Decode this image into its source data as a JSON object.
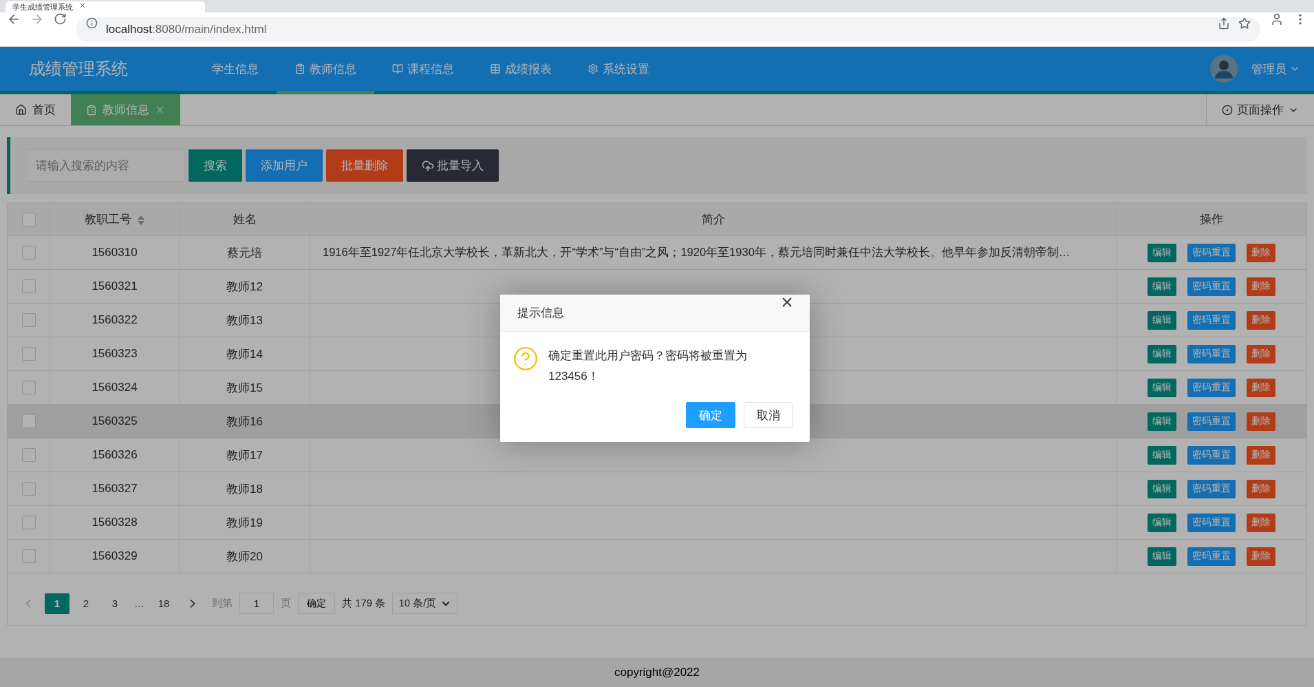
{
  "browser": {
    "tab_title": "学生成绩管理系统",
    "url_host": "localhost",
    "url_rest": ":8080/main/index.html"
  },
  "header": {
    "logo": "成绩管理系统",
    "nav": [
      {
        "label": "学生信息",
        "selected": false
      },
      {
        "label": "教师信息",
        "selected": true
      },
      {
        "label": "课程信息",
        "selected": false
      },
      {
        "label": "成绩报表",
        "selected": false
      },
      {
        "label": "系统设置",
        "selected": false
      }
    ],
    "user": "管理员"
  },
  "page_tabs": [
    {
      "label": "首页",
      "selected": false,
      "closable": false
    },
    {
      "label": "教师信息",
      "selected": true,
      "closable": true
    }
  ],
  "page_actions": "页面操作",
  "toolbar": {
    "search": {
      "placeholder": "请输入搜索的内容"
    },
    "buttons": [
      {
        "label": "搜索",
        "kind": "search"
      },
      {
        "label": "添加用户",
        "kind": "add"
      },
      {
        "label": "批量删除",
        "kind": "delete"
      },
      {
        "label": "批量导入",
        "kind": "import"
      }
    ]
  },
  "table": {
    "header_checked": false,
    "columns": [
      "教职工号",
      "姓名",
      "简介",
      "操作"
    ],
    "rows": [
      {
        "id": "1560310",
        "name": "蔡元培",
        "intro": "1916年至1927年任北京大学校长，革新北大，开“学术”与“自由”之风；1920年至1930年，蔡元培同时兼任中法大学校长。他早年参加反清朝帝制…",
        "checked": false,
        "highlighted": false,
        "actions": [
          "编辑",
          "密码重置",
          "删除"
        ]
      },
      {
        "id": "1560321",
        "name": "教师12",
        "checked": false,
        "highlighted": false,
        "actions": [
          "编辑",
          "密码重置",
          "删除"
        ]
      },
      {
        "id": "1560322",
        "name": "教师13",
        "checked": false,
        "highlighted": false,
        "actions": [
          "编辑",
          "密码重置",
          "删除"
        ]
      },
      {
        "id": "1560323",
        "name": "教师14",
        "checked": false,
        "highlighted": false,
        "actions": [
          "编辑",
          "密码重置",
          "删除"
        ]
      },
      {
        "id": "1560324",
        "name": "教师15",
        "checked": false,
        "highlighted": false,
        "actions": [
          "编辑",
          "密码重置",
          "删除"
        ]
      },
      {
        "id": "1560325",
        "name": "教师16",
        "checked": false,
        "highlighted": true,
        "actions": [
          "编辑",
          "密码重置",
          "删除"
        ]
      },
      {
        "id": "1560326",
        "name": "教师17",
        "checked": false,
        "highlighted": false,
        "actions": [
          "编辑",
          "密码重置",
          "删除"
        ]
      },
      {
        "id": "1560327",
        "name": "教师18",
        "checked": false,
        "highlighted": false,
        "actions": [
          "编辑",
          "密码重置",
          "删除"
        ]
      },
      {
        "id": "1560328",
        "name": "教师19",
        "checked": false,
        "highlighted": false,
        "actions": [
          "编辑",
          "密码重置",
          "删除"
        ]
      },
      {
        "id": "1560329",
        "name": "教师20",
        "checked": false,
        "highlighted": false,
        "actions": [
          "编辑",
          "密码重置",
          "删除"
        ]
      }
    ]
  },
  "pagination": {
    "prev_disabled": true,
    "pages": [
      {
        "label": "1",
        "selected": true
      },
      {
        "label": "2",
        "selected": false
      },
      {
        "label": "3",
        "selected": false
      }
    ],
    "ellipsis": "…",
    "last": "18",
    "goto_label": "到第",
    "goto_value": "1",
    "page_unit": "页",
    "confirm": "确定",
    "total": "共 179 条",
    "page_size": "10 条/页"
  },
  "footer": "copyright@2022",
  "dialog": {
    "title": "提示信息",
    "message": "确定重置此用户密码？密码将被重置为123456！",
    "buttons": [
      {
        "label": "确定",
        "kind": "primary"
      },
      {
        "label": "取消",
        "kind": "default"
      }
    ]
  }
}
